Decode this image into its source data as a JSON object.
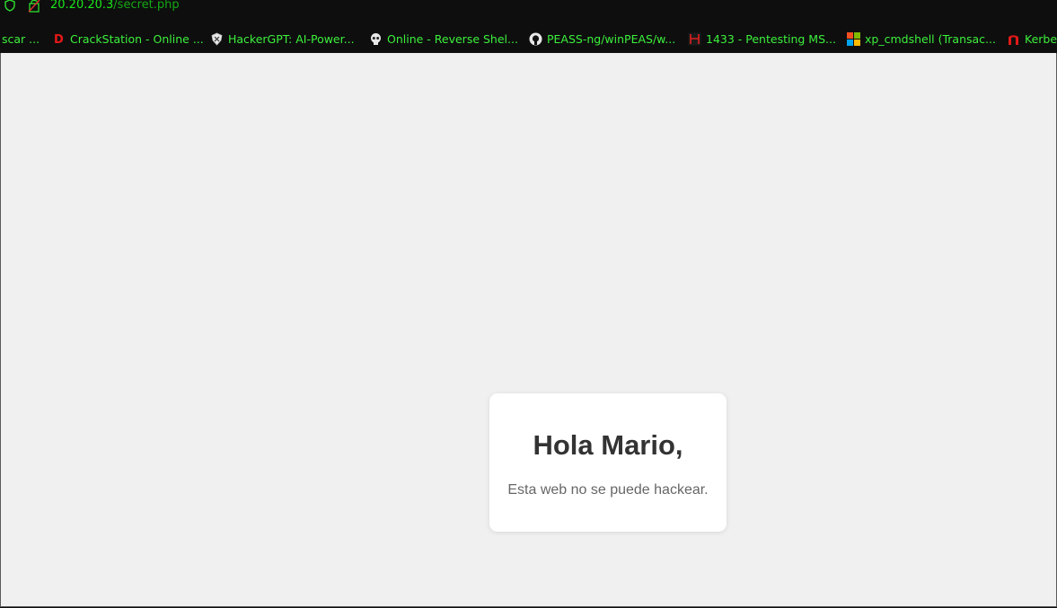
{
  "address_bar": {
    "host": "20.20.20.3",
    "path": "/secret.php"
  },
  "bookmarks": [
    {
      "label": "scar ...",
      "icon": "none"
    },
    {
      "label": "CrackStation - Online ...",
      "icon": "crackstation-d-icon"
    },
    {
      "label": "HackerGPT: AI-Power...",
      "icon": "shield-logo-icon"
    },
    {
      "label": "Online - Reverse Shel...",
      "icon": "skull-icon"
    },
    {
      "label": "PEASS-ng/winPEAS/w...",
      "icon": "github-icon"
    },
    {
      "label": "1433 - Pentesting MS...",
      "icon": "hacktricks-icon"
    },
    {
      "label": "xp_cmdshell (Transac...",
      "icon": "microsoft-icon"
    },
    {
      "label": "Kerbe",
      "icon": "magnet-icon"
    }
  ],
  "page": {
    "heading": "Hola Mario,",
    "message": "Esta web no se puede hackear."
  },
  "colors": {
    "url_green": "#19e619",
    "bookmark_green": "#3cf03c",
    "page_background": "#f0f0f0",
    "card_background": "#ffffff"
  }
}
